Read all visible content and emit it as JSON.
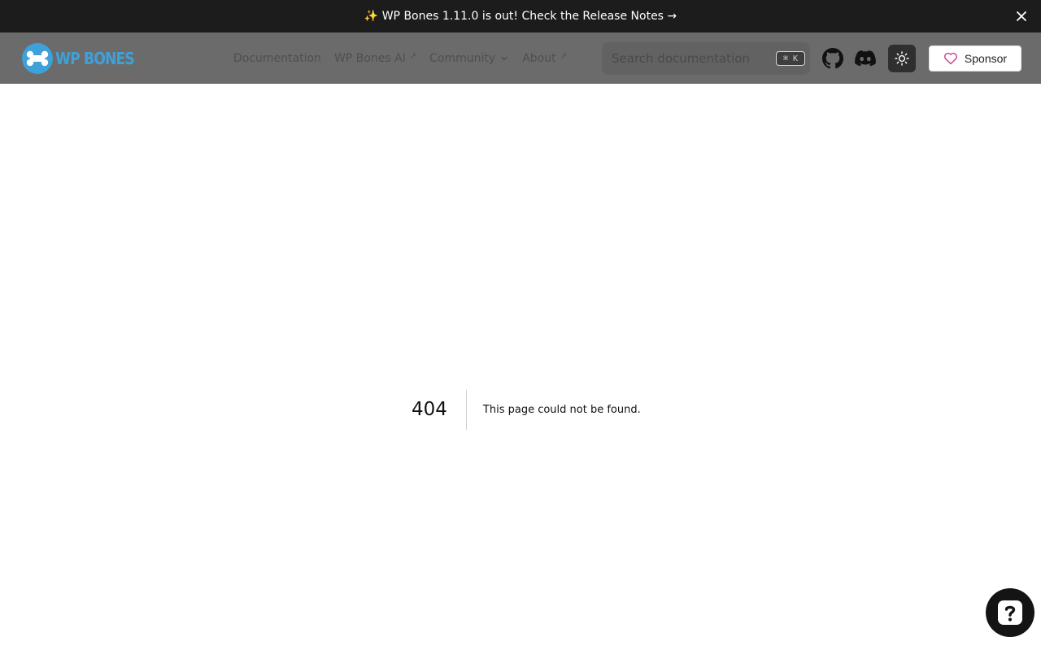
{
  "banner": {
    "text": "✨ WP Bones 1.11.0 is out! Check the Release Notes →"
  },
  "header": {
    "logo_text": "WP BONES",
    "nav": [
      {
        "label": "Documentation"
      },
      {
        "label": "WP Bones AI"
      },
      {
        "label": "Community"
      },
      {
        "label": "About"
      }
    ],
    "search": {
      "placeholder": "Search documentation",
      "shortcut": "⌘ K"
    },
    "sponsor_label": "Sponsor"
  },
  "error": {
    "code": "404",
    "message": "This page could not be found."
  },
  "icons": {
    "banner_close": "close-icon",
    "github": "github-icon",
    "discord": "discord-icon",
    "theme": "sun-icon",
    "sponsor": "heart-icon",
    "help": "question-icon"
  },
  "colors": {
    "banner_bg": "#1c1c1c",
    "header_bg": "#6b6b6b",
    "brand": "#3fa1d9",
    "help_bg": "#141414"
  }
}
